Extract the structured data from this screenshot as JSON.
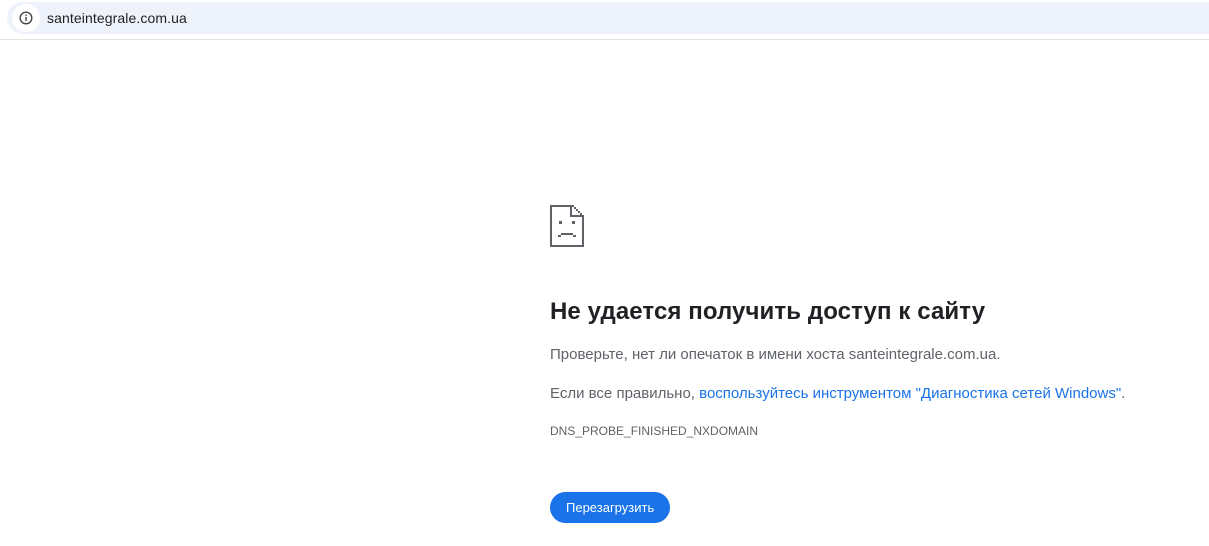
{
  "omnibox": {
    "url": "santeintegrale.com.ua",
    "icon": "info-icon"
  },
  "error_page": {
    "icon": "sad-page-icon",
    "title": "Не удается получить доступ к сайту",
    "check_text": "Проверьте, нет ли опечаток в имени хоста santeintegrale.com.ua.",
    "if_correct_prefix": "Если все правильно, ",
    "diagnostics_link": "воспользуйтесь инструментом \"Диагностика сетей Windows\"",
    "if_correct_suffix": ".",
    "error_code": "DNS_PROBE_FINISHED_NXDOMAIN",
    "reload_label": "Перезагрузить"
  },
  "colors": {
    "accent": "#1a73e8",
    "text_primary": "#202124",
    "text_secondary": "#5f6368",
    "omnibox_bg": "#eef2fa"
  }
}
